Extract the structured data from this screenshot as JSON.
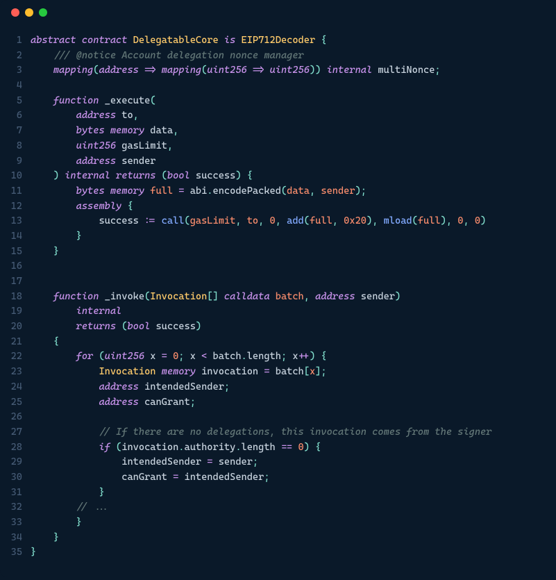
{
  "titlebar": {
    "dots": [
      "red",
      "yellow",
      "green"
    ]
  },
  "code": {
    "language": "solidity",
    "line_count": 35,
    "tokens": {
      "l1": {
        "abstract": "abstract",
        "contract": "contract",
        "name": "DelegatableCore",
        "is": "is",
        "base": "EIP712Decoder",
        "lb": "{"
      },
      "l2": {
        "comment": "/// @notice Account delegation nonce manager"
      },
      "l3": {
        "mapping1": "mapping",
        "lp1": "(",
        "addr1": "address",
        "arrow1": "=>",
        "mapping2": "mapping",
        "lp2": "(",
        "u1": "uint256",
        "arrow2": "=>",
        "u2": "uint256",
        "rp2": ")",
        "rp1": ")",
        "internal": "internal",
        "var": "multiNonce",
        "semi": ";"
      },
      "l5": {
        "function": "function",
        "name": "_execute",
        "lp": "("
      },
      "l6": {
        "type": "address",
        "name": "to",
        "comma": ","
      },
      "l7": {
        "type": "bytes",
        "mem": "memory",
        "name": "data",
        "comma": ","
      },
      "l8": {
        "type": "uint256",
        "name": "gasLimit",
        "comma": ","
      },
      "l9": {
        "type": "address",
        "name": "sender"
      },
      "l10": {
        "rp": ")",
        "internal": "internal",
        "returns": "returns",
        "lp": "(",
        "bool": "bool",
        "var": "success",
        "rp2": ")",
        "lb": "{"
      },
      "l11": {
        "type": "bytes",
        "mem": "memory",
        "var": "full",
        "eq": "=",
        "abi": "abi",
        "dot": ".",
        "fn": "encodePacked",
        "lp": "(",
        "a1": "data",
        "c": ",",
        "a2": "sender",
        "rp": ")",
        "semi": ";"
      },
      "l12": {
        "assembly": "assembly",
        "lb": "{"
      },
      "l13": {
        "var": "success",
        "assign": ":=",
        "call": "call",
        "lp": "(",
        "a1": "gasLimit",
        "c1": ",",
        "a2": "to",
        "c2": ",",
        "a3": "0",
        "c3": ",",
        "add": "add",
        "lp2": "(",
        "a4": "full",
        "c4": ",",
        "a5": "0x20",
        "rp2": ")",
        "c5": ",",
        "mload": "mload",
        "lp3": "(",
        "a6": "full",
        "rp3": ")",
        "c6": ",",
        "a7": "0",
        "c7": ",",
        "a8": "0",
        "rp": ")"
      },
      "l14": {
        "rb": "}"
      },
      "l15": {
        "rb": "}"
      },
      "l18": {
        "function": "function",
        "name": "_invoke",
        "lp": "(",
        "type": "Invocation",
        "br": "[]",
        "cd": "calldata",
        "var": "batch",
        "c": ",",
        "addr": "address",
        "var2": "sender",
        "rp": ")"
      },
      "l19": {
        "internal": "internal"
      },
      "l20": {
        "returns": "returns",
        "lp": "(",
        "bool": "bool",
        "var": "success",
        "rp": ")"
      },
      "l21": {
        "lb": "{"
      },
      "l22": {
        "for": "for",
        "lp": "(",
        "type": "uint256",
        "var": "x",
        "eq": "=",
        "zero": "0",
        "semi": ";",
        "var2": "x",
        "lt": "<",
        "batch": "batch",
        "dot": ".",
        "len": "length",
        "semi2": ";",
        "var3": "x",
        "inc": "++",
        "rp": ")",
        "lb": "{"
      },
      "l23": {
        "type": "Invocation",
        "mem": "memory",
        "var": "invocation",
        "eq": "=",
        "batch": "batch",
        "lb": "[",
        "x": "x",
        "rb": "]",
        "semi": ";"
      },
      "l24": {
        "type": "address",
        "var": "intendedSender",
        "semi": ";"
      },
      "l25": {
        "type": "address",
        "var": "canGrant",
        "semi": ";"
      },
      "l27": {
        "comment": "// If there are no delegations, this invocation comes from the signer"
      },
      "l28": {
        "if": "if",
        "lp": "(",
        "inv": "invocation",
        "d1": ".",
        "auth": "authority",
        "d2": ".",
        "len": "length",
        "eq": "==",
        "zero": "0",
        "rp": ")",
        "lb": "{"
      },
      "l29": {
        "var": "intendedSender",
        "eq": "=",
        "val": "sender",
        "semi": ";"
      },
      "l30": {
        "var": "canGrant",
        "eq": "=",
        "val": "intendedSender",
        "semi": ";"
      },
      "l31": {
        "rb": "}"
      },
      "l32": {
        "comment": "// ..."
      },
      "l33": {
        "rb": "}"
      },
      "l34": {
        "rb": "}"
      },
      "l35": {
        "rb": "}"
      }
    }
  }
}
